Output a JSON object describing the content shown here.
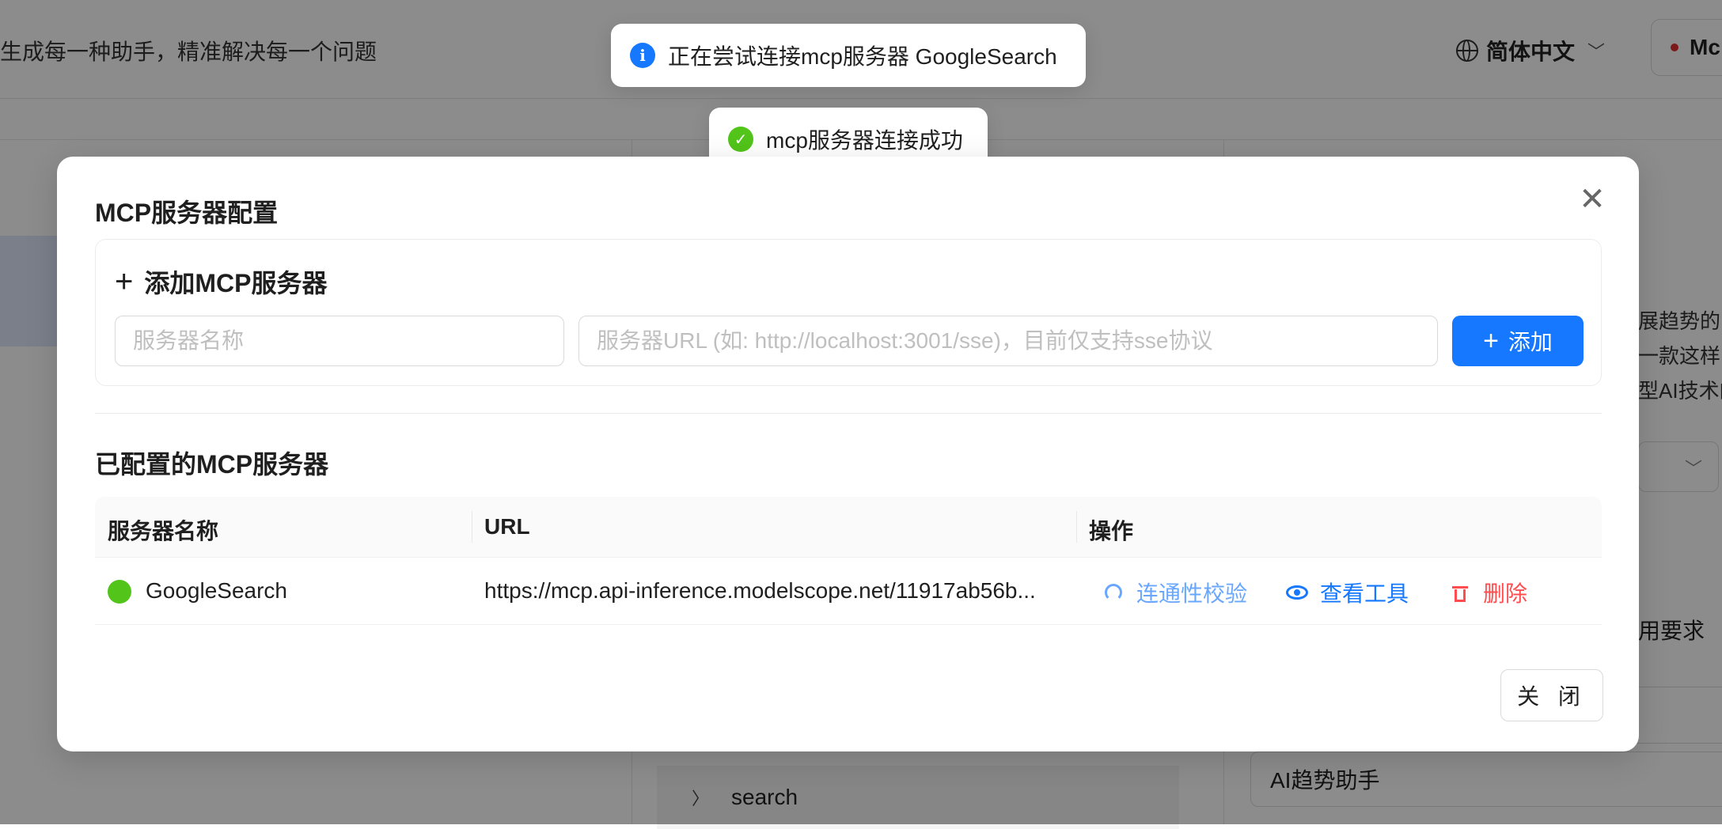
{
  "background": {
    "slogan": "生成每一种助手，精准解决每一个问题",
    "language": "简体中文",
    "model_label": "Mc",
    "right_text_lines": [
      "展趋势的",
      "一款这样的",
      "型AI技术的"
    ],
    "requirement_label": "用要求",
    "assistant_name_value": "AI趋势助手",
    "tree_item": "search"
  },
  "toasts": {
    "info": "正在尝试连接mcp服务器 GoogleSearch",
    "success": "mcp服务器连接成功"
  },
  "modal": {
    "title": "MCP服务器配置",
    "add_section": {
      "title": "添加MCP服务器",
      "name_placeholder": "服务器名称",
      "url_placeholder": "服务器URL (如: http://localhost:3001/sse)，目前仅支持sse协议",
      "add_button": "添加"
    },
    "configured_title": "已配置的MCP服务器",
    "table": {
      "headers": [
        "服务器名称",
        "URL",
        "操作"
      ],
      "rows": [
        {
          "name": "GoogleSearch",
          "url": "https://mcp.api-inference.modelscope.net/11917ab56b...",
          "status_color": "#52c41a",
          "actions": {
            "check": "连通性校验",
            "tools": "查看工具",
            "delete": "删除"
          }
        }
      ]
    },
    "close_button": "关 闭"
  },
  "colors": {
    "primary": "#1677ff",
    "success": "#52c41a",
    "danger": "#ff4d4f"
  }
}
